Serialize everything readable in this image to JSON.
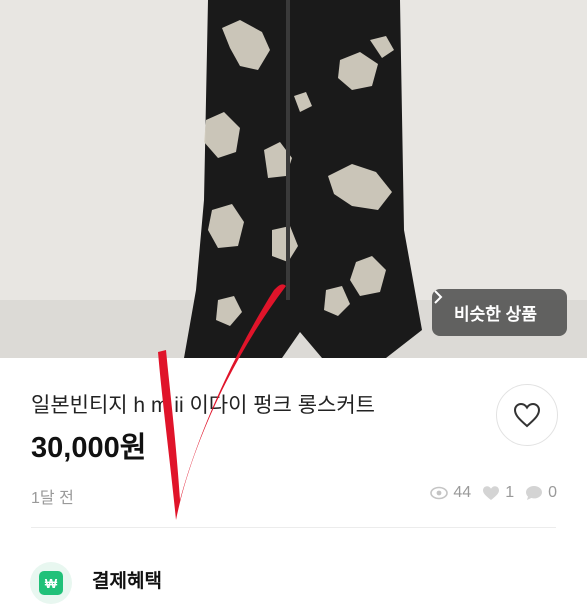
{
  "product": {
    "similar_button": "비슷한 상품",
    "title": "일본빈티지 h m ii 이다이 펑크 롱스커트",
    "price": "30,000원",
    "posted": "1달 전",
    "stats": {
      "views": "44",
      "likes": "1",
      "chats": "0"
    }
  },
  "benefit": {
    "title": "결제혜택",
    "icon_text": "₩"
  },
  "colors": {
    "accent": "#21c179",
    "mark": "#e0142a",
    "skirt": "#1a1a1a"
  },
  "icons": [
    "chevron-right-icon",
    "heart-icon",
    "eye-icon",
    "chat-bubble-icon",
    "won-icon"
  ]
}
